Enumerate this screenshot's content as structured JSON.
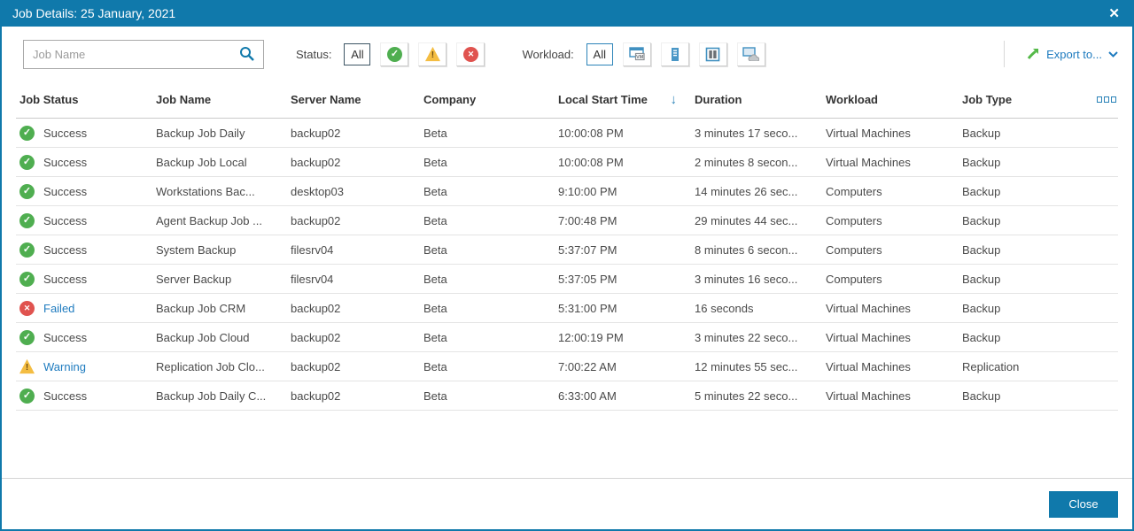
{
  "window": {
    "title": "Job Details: 25 January, 2021"
  },
  "colors": {
    "accent_blue": "#1079ab",
    "link_blue": "#1e7bbf",
    "success_green": "#4fae50",
    "warning_amber": "#f4bd42",
    "error_red": "#e0534f"
  },
  "toolbar": {
    "search": {
      "placeholder": "Job Name"
    },
    "status": {
      "label": "Status:",
      "all_label": "All"
    },
    "workload": {
      "label": "Workload:",
      "all_label": "All"
    },
    "export": {
      "label": "Export to..."
    }
  },
  "icons": {
    "titlebar_close": "close-x",
    "search": "magnifier",
    "status_success": "check-circle",
    "status_warning": "warning-triangle",
    "status_failed": "x-circle",
    "workload_vm": "vm-screen",
    "workload_server": "server-tower",
    "workload_computers": "computer-cabinet",
    "workload_cloud": "screen-cloud",
    "export_arrow": "arrow-up-right",
    "export_chevron": "chevron-down",
    "sort_desc": "↓",
    "column_chooser": "three-squares"
  },
  "table": {
    "columns": [
      "Job Status",
      "Job Name",
      "Server Name",
      "Company",
      "Local Start Time",
      "Duration",
      "Workload",
      "Job Type"
    ],
    "sort": {
      "column": "Local Start Time",
      "direction": "desc"
    },
    "rows": [
      {
        "status": "Success",
        "status_kind": "success",
        "job_name": "Backup Job Daily",
        "server_name": "backup02",
        "company": "Beta",
        "start_time": "10:00:08 PM",
        "duration": "3 minutes 17 seco...",
        "workload": "Virtual Machines",
        "job_type": "Backup"
      },
      {
        "status": "Success",
        "status_kind": "success",
        "job_name": "Backup Job Local",
        "server_name": "backup02",
        "company": "Beta",
        "start_time": "10:00:08 PM",
        "duration": "2 minutes 8 secon...",
        "workload": "Virtual Machines",
        "job_type": "Backup"
      },
      {
        "status": "Success",
        "status_kind": "success",
        "job_name": "Workstations Bac...",
        "server_name": "desktop03",
        "company": "Beta",
        "start_time": "9:10:00 PM",
        "duration": "14 minutes 26 sec...",
        "workload": "Computers",
        "job_type": "Backup"
      },
      {
        "status": "Success",
        "status_kind": "success",
        "job_name": "Agent Backup Job ...",
        "server_name": "backup02",
        "company": "Beta",
        "start_time": "7:00:48 PM",
        "duration": "29 minutes 44 sec...",
        "workload": "Computers",
        "job_type": "Backup"
      },
      {
        "status": "Success",
        "status_kind": "success",
        "job_name": "System Backup",
        "server_name": "filesrv04",
        "company": "Beta",
        "start_time": "5:37:07 PM",
        "duration": "8 minutes 6 secon...",
        "workload": "Computers",
        "job_type": "Backup"
      },
      {
        "status": "Success",
        "status_kind": "success",
        "job_name": "Server Backup",
        "server_name": "filesrv04",
        "company": "Beta",
        "start_time": "5:37:05 PM",
        "duration": "3 minutes 16 seco...",
        "workload": "Computers",
        "job_type": "Backup"
      },
      {
        "status": "Failed",
        "status_kind": "error",
        "job_name": "Backup Job CRM",
        "server_name": "backup02",
        "company": "Beta",
        "start_time": "5:31:00 PM",
        "duration": "16 seconds",
        "workload": "Virtual Machines",
        "job_type": "Backup"
      },
      {
        "status": "Success",
        "status_kind": "success",
        "job_name": "Backup Job Cloud",
        "server_name": "backup02",
        "company": "Beta",
        "start_time": "12:00:19 PM",
        "duration": "3 minutes 22 seco...",
        "workload": "Virtual Machines",
        "job_type": "Backup"
      },
      {
        "status": "Warning",
        "status_kind": "warning",
        "job_name": "Replication Job Clo...",
        "server_name": "backup02",
        "company": "Beta",
        "start_time": "7:00:22 AM",
        "duration": "12 minutes 55 sec...",
        "workload": "Virtual Machines",
        "job_type": "Replication"
      },
      {
        "status": "Success",
        "status_kind": "success",
        "job_name": "Backup Job Daily C...",
        "server_name": "backup02",
        "company": "Beta",
        "start_time": "6:33:00 AM",
        "duration": "5 minutes 22 seco...",
        "workload": "Virtual Machines",
        "job_type": "Backup"
      }
    ]
  },
  "footer": {
    "close_label": "Close"
  }
}
